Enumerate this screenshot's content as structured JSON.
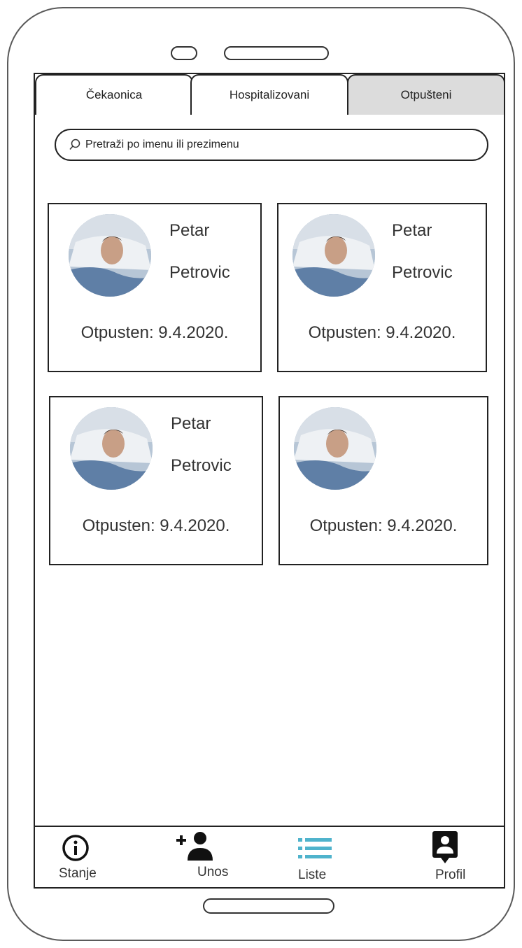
{
  "tabs": [
    {
      "label": "Čekaonica",
      "active": false
    },
    {
      "label": "Hospitalizovani",
      "active": false
    },
    {
      "label": "Otpušteni",
      "active": true
    }
  ],
  "search": {
    "placeholder": "Pretraži po imenu ili prezimenu",
    "value": "",
    "icon": "search-icon"
  },
  "patients": [
    {
      "first_name": "Petar",
      "last_name": "Petrovic",
      "discharged": "Otpusten: 9.4.2020."
    },
    {
      "first_name": "Petar",
      "last_name": "Petrovic",
      "discharged": "Otpusten: 9.4.2020."
    },
    {
      "first_name": "Petar",
      "last_name": "Petrovic",
      "discharged": "Otpusten: 9.4.2020."
    },
    {
      "first_name": "",
      "last_name": "",
      "discharged": "Otpusten: 9.4.2020."
    }
  ],
  "nav": [
    {
      "label": "Stanje",
      "icon": "info-icon"
    },
    {
      "label": "Unos",
      "icon": "add-user-icon"
    },
    {
      "label": "Liste",
      "icon": "list-icon",
      "active": true
    },
    {
      "label": "Profil",
      "icon": "profile-icon"
    }
  ],
  "colors": {
    "active_tab_bg": "#dcdcdc",
    "accent": "#4fb3cc",
    "border": "#222222"
  }
}
